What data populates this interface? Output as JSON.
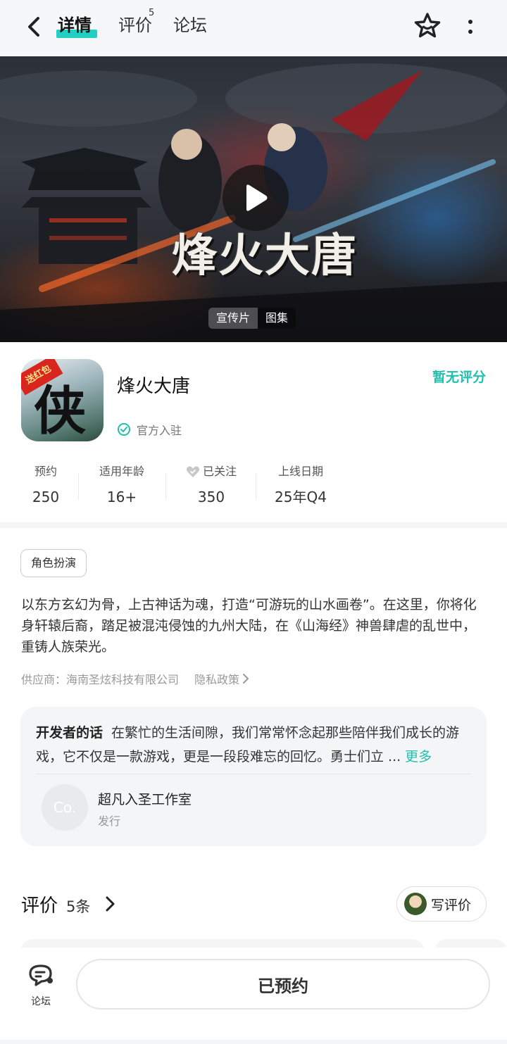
{
  "header": {
    "tabs": [
      {
        "label": "详情",
        "active": true
      },
      {
        "label": "评价",
        "badge": "5"
      },
      {
        "label": "论坛"
      }
    ],
    "icons": {
      "back": "back-arrow-icon",
      "favorite": "star-icon",
      "more": "more-vertical-icon"
    }
  },
  "banner": {
    "title_art": "烽火大唐",
    "segments": [
      "宣传片",
      "图集"
    ],
    "active_segment": 0
  },
  "app": {
    "name": "烽火大唐",
    "icon_glyph": "侠",
    "icon_ribbon": "送红包",
    "official": "官方入驻",
    "score_text": "暂无评分"
  },
  "stats": [
    {
      "label": "预约",
      "value": "250"
    },
    {
      "label": "适用年龄",
      "value": "16+"
    },
    {
      "label": "已关注",
      "value": "350",
      "icon": "heart-icon"
    },
    {
      "label": "上线日期",
      "value": "25年Q4"
    }
  ],
  "tag": "角色扮演",
  "description": "以东方玄幻为骨，上古神话为魂，打造“可游玩的山水画卷”。在这里，你将化身轩辕后裔，踏足被混沌侵蚀的九州大陆，在《山海经》神兽肆虐的乱世中，重铸人族荣光。",
  "supplier": {
    "text": "供应商：海南圣炫科技有限公司",
    "privacy": "隐私政策"
  },
  "developer": {
    "heading": "开发者的话",
    "text": "在繁忙的生活间隙，我们常常怀念起那些陪伴我们成长的游戏，它不仅是一款游戏，更是一段段难忘的回忆。勇士们立 ...",
    "more": "更多",
    "avatar_text": "Co.",
    "name": "超凡入圣工作室",
    "role": "发行"
  },
  "reviews": {
    "title": "评价",
    "count": "5条",
    "write_label": "写评价"
  },
  "bottom": {
    "forum_label": "论坛",
    "reserve_label": "已预约"
  },
  "colors": {
    "accent": "#21d0c1",
    "accent_text": "#20bfae",
    "panel": "#f4f5f6"
  }
}
